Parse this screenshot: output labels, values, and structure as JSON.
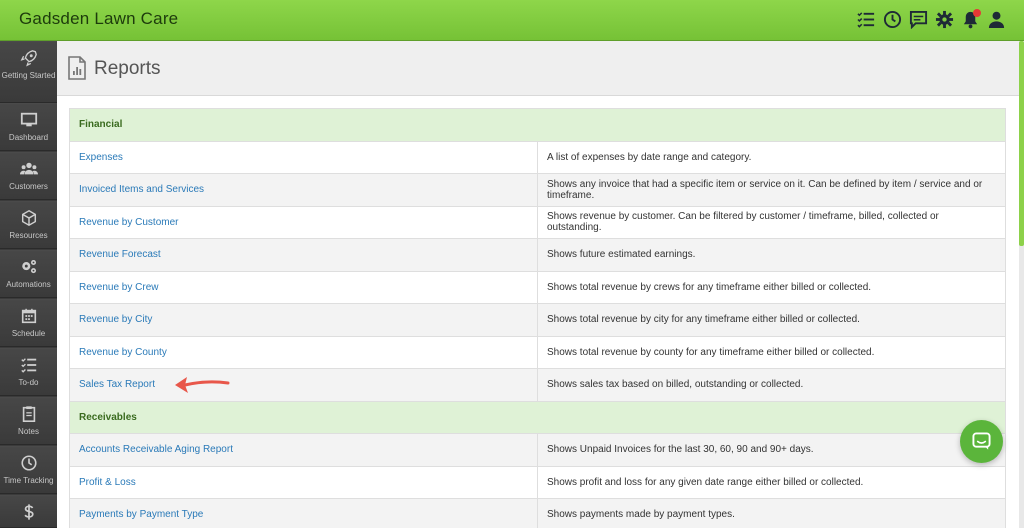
{
  "app": {
    "title": "Gadsden Lawn Care"
  },
  "topbar": {
    "icons": [
      "checklist-icon",
      "clock-icon",
      "chat-icon",
      "gear-icon",
      "bell-icon",
      "user-icon"
    ],
    "notification_dot_color": "#e53935"
  },
  "sidebar": {
    "items": [
      {
        "label": "Getting Started",
        "icon": "rocket-icon"
      },
      {
        "label": "Dashboard",
        "icon": "monitor-icon"
      },
      {
        "label": "Customers",
        "icon": "users-icon"
      },
      {
        "label": "Resources",
        "icon": "box-icon"
      },
      {
        "label": "Automations",
        "icon": "gears-icon"
      },
      {
        "label": "Schedule",
        "icon": "calendar-icon"
      },
      {
        "label": "To-do",
        "icon": "checklist-icon"
      },
      {
        "label": "Notes",
        "icon": "clipboard-icon"
      },
      {
        "label": "Time Tracking",
        "icon": "clock-icon"
      },
      {
        "label": "",
        "icon": "dollar-icon"
      }
    ]
  },
  "page": {
    "title": "Reports"
  },
  "sections": [
    {
      "title": "Financial",
      "rows": [
        {
          "name": "Expenses",
          "description": "A list of expenses by date range and category."
        },
        {
          "name": "Invoiced Items and Services",
          "description": "Shows any invoice that had a specific item or service on it. Can be defined by item / service and or timeframe."
        },
        {
          "name": "Revenue by Customer",
          "description": "Shows revenue by customer. Can be filtered by customer / timeframe, billed, collected or outstanding."
        },
        {
          "name": "Revenue Forecast",
          "description": "Shows future estimated earnings."
        },
        {
          "name": "Revenue by Crew",
          "description": "Shows total revenue by crews for any timeframe either billed or collected."
        },
        {
          "name": "Revenue by City",
          "description": "Shows total revenue by city for any timeframe either billed or collected."
        },
        {
          "name": "Revenue by County",
          "description": "Shows total revenue by county for any timeframe either billed or collected."
        },
        {
          "name": "Sales Tax Report",
          "description": "Shows sales tax based on billed, outstanding or collected."
        }
      ]
    },
    {
      "title": "Receivables",
      "rows": [
        {
          "name": "Accounts Receivable Aging Report",
          "description": "Shows Unpaid Invoices for the last 30, 60, 90 and 90+ days."
        },
        {
          "name": "Profit & Loss",
          "description": "Shows profit and loss for any given date range either billed or collected."
        },
        {
          "name": "Payments by Payment Type",
          "description": "Shows payments made by payment types."
        }
      ]
    }
  ],
  "colors": {
    "accent_green": "#7ccb3b",
    "link_blue": "#2a7ab8",
    "section_bg": "#dff2d6",
    "arrow_red": "#e8574a",
    "chat_green": "#5bb53b"
  }
}
